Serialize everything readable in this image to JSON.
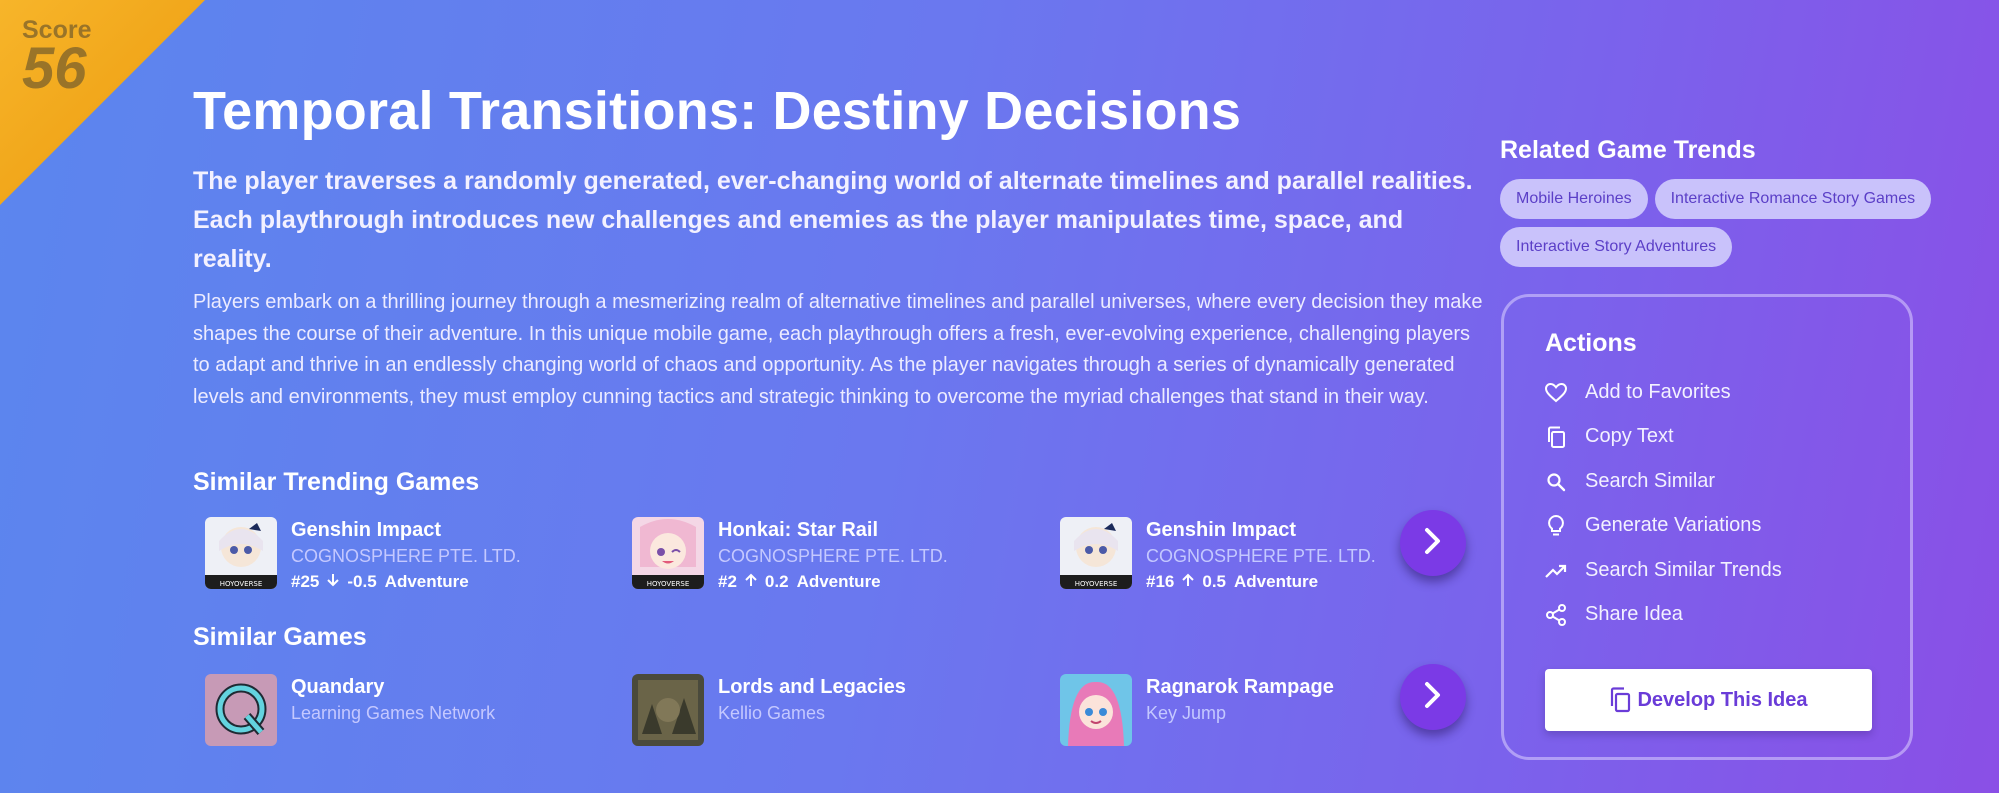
{
  "score": {
    "label": "Score",
    "value": "56"
  },
  "idea": {
    "title": "Temporal Transitions: Destiny Decisions",
    "summary": "The player traverses a randomly generated, ever-changing world of alternate timelines and parallel realities. Each playthrough introduces new challenges and enemies as the player manipulates time, space, and reality.",
    "description": "Players embark on a thrilling journey through a mesmerizing realm of alternative timelines and parallel universes, where every decision they make shapes the course of their adventure. In this unique mobile game, each playthrough offers a fresh, ever-evolving experience, challenging players to adapt and thrive in an endlessly changing world of chaos and opportunity. As the player navigates through a series of dynamically generated levels and environments, they must employ cunning tactics and strategic thinking to overcome the myriad challenges that stand in their way."
  },
  "similar_trending": {
    "title": "Similar Trending Games",
    "games": [
      {
        "name": "Genshin Impact",
        "developer": "COGNOSPHERE PTE. LTD.",
        "rank": "#25",
        "trend_icon": "arrow-down-icon",
        "change": "-0.5",
        "genre": "Adventure"
      },
      {
        "name": "Honkai: Star Rail",
        "developer": "COGNOSPHERE PTE. LTD.",
        "rank": "#2",
        "trend_icon": "arrow-up-icon",
        "change": "0.2",
        "genre": "Adventure"
      },
      {
        "name": "Genshin Impact",
        "developer": "COGNOSPHERE PTE. LTD.",
        "rank": "#16",
        "trend_icon": "arrow-up-icon",
        "change": "0.5",
        "genre": "Adventure"
      }
    ]
  },
  "similar_games": {
    "title": "Similar Games",
    "games": [
      {
        "name": "Quandary",
        "developer": "Learning Games Network"
      },
      {
        "name": "Lords and Legacies",
        "developer": "Kellio Games"
      },
      {
        "name": "Ragnarok Rampage",
        "developer": "Key Jump"
      }
    ]
  },
  "related_trends": {
    "title": "Related Game Trends",
    "chips": [
      "Mobile Heroines",
      "Interactive Romance Story Games",
      "Interactive Story Adventures"
    ]
  },
  "actions": {
    "title": "Actions",
    "items": [
      {
        "label": "Add to Favorites",
        "icon": "heart-icon"
      },
      {
        "label": "Copy Text",
        "icon": "copy-icon"
      },
      {
        "label": "Search Similar",
        "icon": "search-icon"
      },
      {
        "label": "Generate Variations",
        "icon": "lightbulb-icon"
      },
      {
        "label": "Search Similar Trends",
        "icon": "trending-icon"
      },
      {
        "label": "Share Idea",
        "icon": "share-icon"
      }
    ],
    "develop_label": "Develop This Idea"
  },
  "colors": {
    "accent": "#7b3ae6",
    "score_ribbon": "#f0a418",
    "chip_bg": "#c9c2fb",
    "chip_text": "#5b3fc7"
  }
}
